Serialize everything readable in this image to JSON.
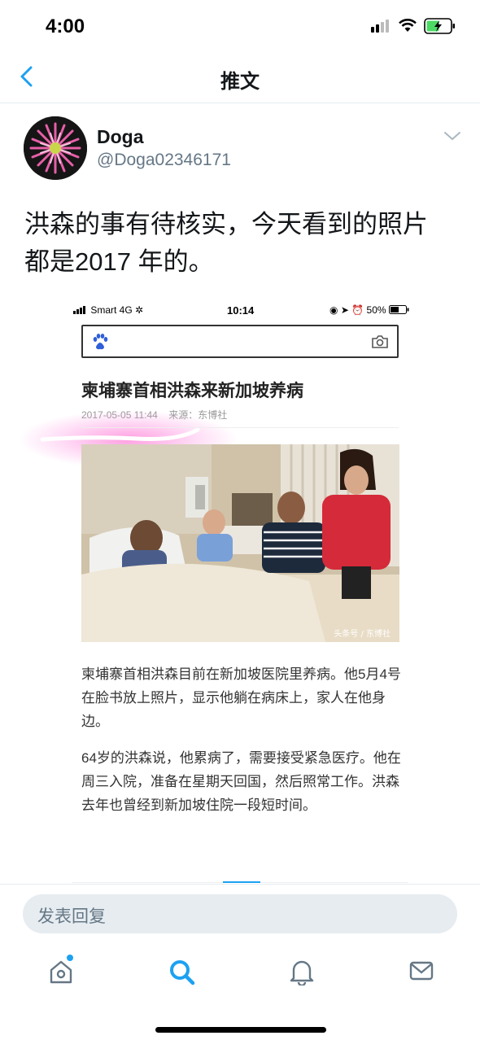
{
  "status_bar": {
    "time": "4:00"
  },
  "header": {
    "title": "推文",
    "back_icon": "chevron-left-icon"
  },
  "tweet": {
    "author_name": "Doga",
    "author_handle": "@Doga02346171",
    "text_line1": "洪森的事有待核实，今天看到的照片",
    "text_line2": "都是2017 年的。"
  },
  "embedded_screenshot": {
    "carrier": "Smart  4G",
    "time": "10:14",
    "right_status": "50%",
    "article_title": "柬埔寨首相洪森来新加坡养病",
    "date": "2017-05-05 11:44",
    "source": "来源：东博社",
    "photo_watermark": "头条号 / 东博社",
    "paragraph1": "柬埔寨首相洪森目前在新加坡医院里养病。他5月4号在脸书放上照片，显示他躺在病床上，家人在他身边。",
    "paragraph2": "64岁的洪森说，他累病了，需要接受紧急医疗。他在周三入院，准备在星期天回国，然后照常工作。洪森去年也曾经到新加坡住院一段短时间。"
  },
  "reply": {
    "placeholder": "发表回复"
  },
  "colors": {
    "accent": "#1da1f2",
    "text": "#14171a",
    "muted": "#657786"
  },
  "tab_bar": [
    "home-icon",
    "search-icon",
    "notifications-icon",
    "messages-icon"
  ]
}
